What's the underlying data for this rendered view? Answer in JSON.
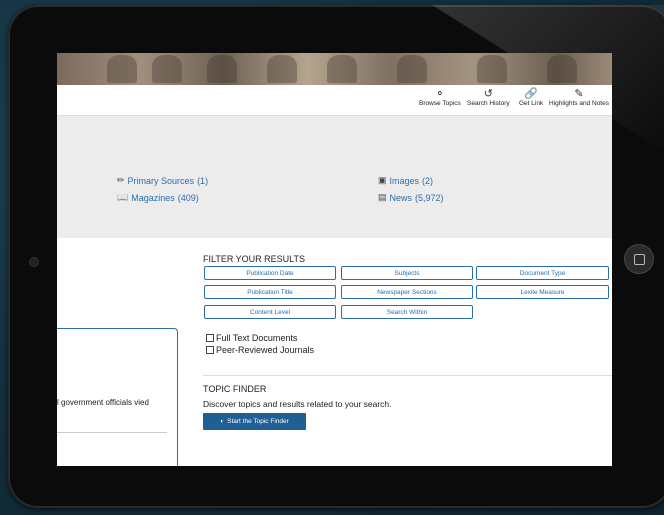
{
  "toolbar": {
    "items": [
      {
        "label": "Browse Topics",
        "icon": "lightbulb-icon"
      },
      {
        "label": "Search History",
        "icon": "history-icon"
      },
      {
        "label": "Get Link",
        "icon": "link-icon"
      },
      {
        "label": "Highlights and Notes",
        "icon": "pencil-icon"
      }
    ]
  },
  "sources": {
    "primary": {
      "label": "Primary Sources",
      "count": "(1)"
    },
    "magazines": {
      "label": "Magazines",
      "count": "(409)"
    },
    "images": {
      "label": "Images",
      "count": "(2)"
    },
    "news": {
      "label": "News",
      "count": "(5,972)"
    }
  },
  "filter": {
    "title": "FILTER YOUR RESULTS",
    "buttons": [
      "Publication Date",
      "Subjects",
      "Document Type",
      "Publication Title",
      "Newspaper Sections",
      "Lexile Measure",
      "Content Level",
      "Search Within"
    ],
    "checkboxes": [
      "Full Text Documents",
      "Peer-Reviewed Journals"
    ]
  },
  "topic_finder": {
    "title": "TOPIC FINDER",
    "description": "Discover topics and results related to your search.",
    "button": "Start the Topic Finder"
  },
  "result_snippet": "l government officials vied"
}
